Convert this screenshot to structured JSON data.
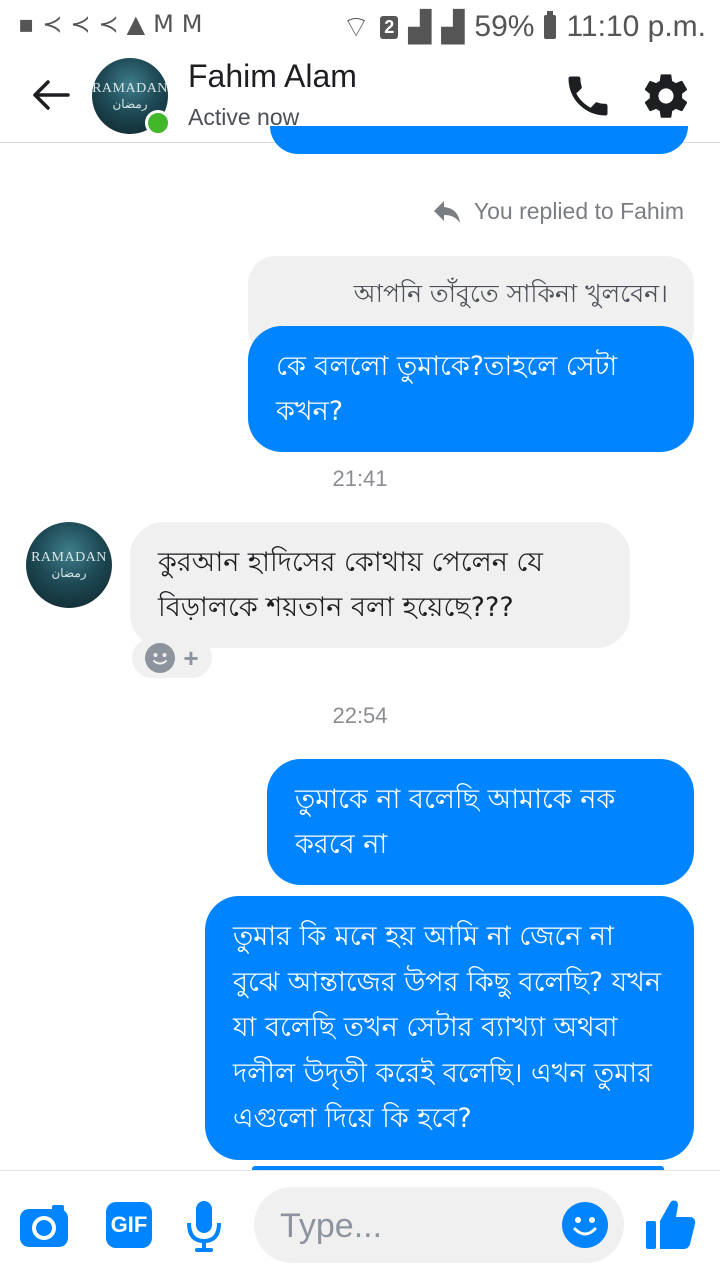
{
  "status_bar": {
    "sim_slot": "2",
    "battery": "59%",
    "time": "11:10 p.m."
  },
  "header": {
    "contact_name": "Fahim Alam",
    "contact_status": "Active now",
    "avatar_text": "RAMADAN",
    "avatar_arabic": "رمضان"
  },
  "thread": {
    "reply_note": "You replied to Fahim",
    "quoted_message": "আপনি তাঁবুতে সাকিনা খুলবেন।",
    "reply_message": "কে বললো তুমাকে?তাহলে সেটা কখন?",
    "timestamp_1": "21:41",
    "incoming_message": "কুরআন হাদিসের কোথায় পেলেন যে বিড়ালকে শয়তান বলা হয়েছে???",
    "timestamp_2": "22:54",
    "outgoing_message_1": "তুমাকে না বলেছি আমাকে নক করবে না",
    "outgoing_message_2": "তুমার কি মনে হয় আমি না জেনে না বুঝে আন্তাজের উপর কিছু বলেছি? যখন যা বলেছি তখন সেটার ব্যাখ্যা অথবা দলীল উদৃতী করেই বলেছি। এখন তুমার এগুলো দিয়ে কি হবে?"
  },
  "composer": {
    "gif_label": "GIF",
    "placeholder": "Type..."
  },
  "colors": {
    "messenger_blue": "#0084ff",
    "incoming_bubble": "#f1f0f0",
    "online_green": "#42b72a"
  },
  "icons": [
    "back-arrow-icon",
    "phone-icon",
    "gear-icon",
    "reply-icon",
    "camera-icon",
    "gif-icon",
    "microphone-icon",
    "emoji-icon",
    "thumbs-up-icon"
  ]
}
